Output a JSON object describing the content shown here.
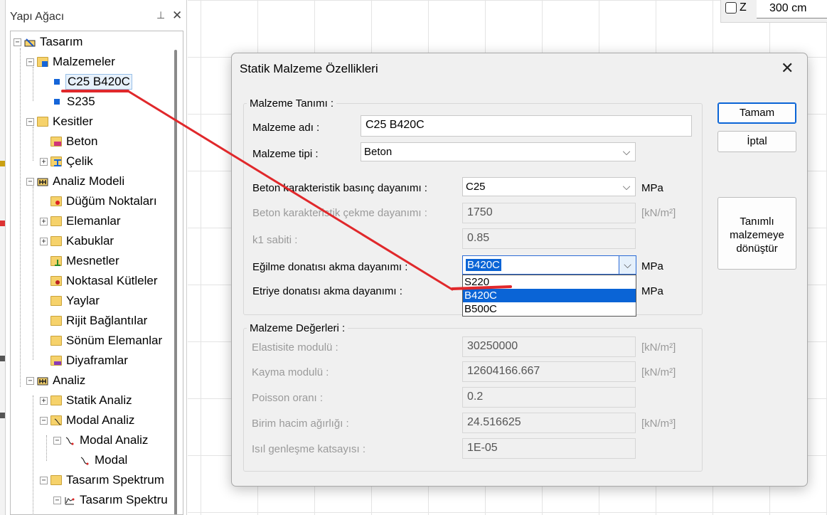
{
  "tree_panel": {
    "title": "Yapı Ağacı",
    "items": [
      {
        "label": "Tasarım",
        "expander": "−"
      },
      {
        "label": "Malzemeler",
        "expander": "−"
      },
      {
        "label": "C25 B420C"
      },
      {
        "label": "S235"
      },
      {
        "label": "Kesitler",
        "expander": "−"
      },
      {
        "label": "Beton"
      },
      {
        "label": "Çelik",
        "expander": "+"
      },
      {
        "label": "Analiz Modeli",
        "expander": "−"
      },
      {
        "label": "Düğüm Noktaları"
      },
      {
        "label": "Elemanlar",
        "expander": "+"
      },
      {
        "label": "Kabuklar",
        "expander": "+"
      },
      {
        "label": "Mesnetler"
      },
      {
        "label": "Noktasal Kütleler"
      },
      {
        "label": "Yaylar"
      },
      {
        "label": "Rijit Bağlantılar"
      },
      {
        "label": "Sönüm Elemanlar"
      },
      {
        "label": "Diyaframlar"
      },
      {
        "label": "Analiz",
        "expander": "−"
      },
      {
        "label": "Statik Analiz",
        "expander": "+"
      },
      {
        "label": "Modal Analiz",
        "expander": "−"
      },
      {
        "label": "Modal Analiz",
        "expander": "−"
      },
      {
        "label": "Modal"
      },
      {
        "label": "Tasarım Spektrum",
        "expander": "−"
      },
      {
        "label": "Tasarım Spektru",
        "expander": "−"
      }
    ]
  },
  "z_toolbar": {
    "label": "Z",
    "value": "300 cm"
  },
  "dialog": {
    "title": "Statik Malzeme Özellikleri",
    "definition_group": {
      "title": "Malzeme Tanımı :",
      "name_label": "Malzeme adı :",
      "name_value": "C25 B420C",
      "type_label": "Malzeme tipi :",
      "type_value": "Beton",
      "fck_label": "Beton karakteristik basınç dayanımı :",
      "fck_value": "C25",
      "fck_unit": "MPa",
      "fctk_label": "Beton karakteristik çekme dayanımı :",
      "fctk_value": "1750",
      "fctk_unit": "[kN/m²]",
      "k1_label": "k1 sabiti :",
      "k1_value": "0.85",
      "fyk_label": "Eğilme donatısı akma dayanımı :",
      "fyk_value": "B420C",
      "fyk_unit": "MPa",
      "fywk_label": "Etriye donatısı akma dayanımı :",
      "fywk_unit": "MPa",
      "dropdown_options": [
        "S220",
        "B420C",
        "B500C"
      ],
      "dropdown_selected": "B420C"
    },
    "values_group": {
      "title": "Malzeme Değerleri :",
      "rows": [
        {
          "label": "Elastisite modulü :",
          "value": "30250000",
          "unit": "[kN/m²]"
        },
        {
          "label": "Kayma modulü :",
          "value": "12604166.667",
          "unit": "[kN/m²]"
        },
        {
          "label": "Poisson oranı :",
          "value": "0.2",
          "unit": ""
        },
        {
          "label": "Birim hacim ağırlığı :",
          "value": "24.516625",
          "unit": "[kN/m³]"
        },
        {
          "label": "Isıl genleşme katsayısı :",
          "value": "1E-05",
          "unit": ""
        }
      ]
    },
    "buttons": {
      "ok": "Tamam",
      "cancel": "İptal",
      "convert": "Tanımlı malzemeye dönüştür"
    }
  },
  "colors": {
    "annotation": "#e0282b",
    "selection": "#0a64d6"
  }
}
